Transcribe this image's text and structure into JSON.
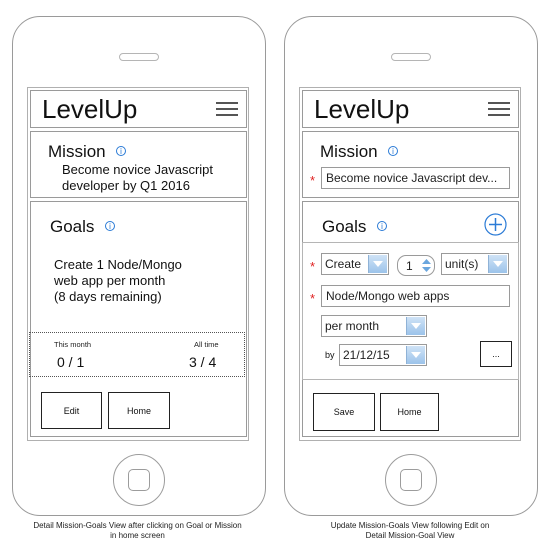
{
  "app_name": "LevelUp",
  "left": {
    "mission_heading": "Mission",
    "mission_text_line1": "Become novice Javascript",
    "mission_text_line2": "developer by Q1 2016",
    "goals_heading": "Goals",
    "goal_line1": "Create 1 Node/Mongo",
    "goal_line2": "web app per month",
    "goal_line3": "(8 days remaining)",
    "stats": {
      "this_month_label": "This month",
      "this_month_value": "0 / 1",
      "all_time_label": "All time",
      "all_time_value": "3 / 4"
    },
    "buttons": {
      "edit": "Edit",
      "home": "Home"
    },
    "caption_line1": "Detail Mission-Goals View after clicking on Goal or Mission",
    "caption_line2": "in home screen"
  },
  "right": {
    "mission_heading": "Mission",
    "mission_input_value": "Become novice Javascript dev...",
    "goals_heading": "Goals",
    "required_marker": "*",
    "action_select_value": "Create",
    "quantity_value": "1",
    "unit_select_value": "unit(s)",
    "goal_name_value": "Node/Mongo web apps",
    "frequency_select_value": "per month",
    "by_label": "by",
    "date_value": "21/12/15",
    "more_button_label": "...",
    "buttons": {
      "save": "Save",
      "home": "Home"
    },
    "caption_line1": "Update Mission-Goals View following Edit on",
    "caption_line2": "Detail Mission-Goal View"
  },
  "icons": {
    "info": "info-icon",
    "menu": "hamburger-menu-icon",
    "add": "plus-circle-icon",
    "dropdown": "chevron-down-icon",
    "spinner": "stepper-arrows-icon"
  },
  "colors": {
    "accent": "#2b7bd6",
    "required": "#e02020",
    "dropdown": "#9cc3ea"
  }
}
